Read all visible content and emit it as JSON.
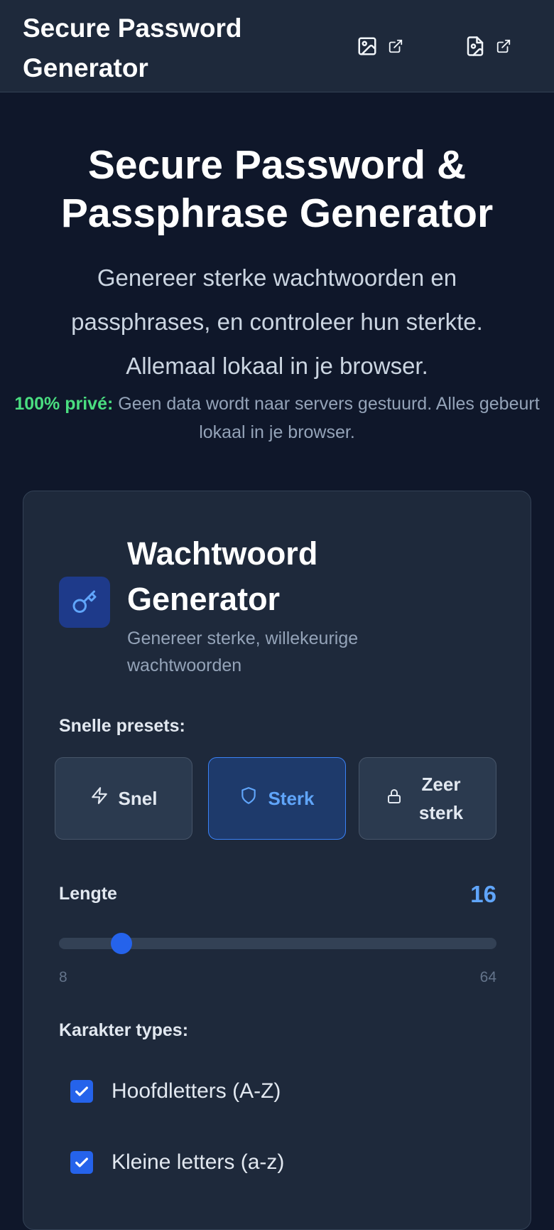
{
  "header": {
    "title": "Secure Password Generator",
    "buttons": [
      {
        "icon": "image-icon",
        "ext_icon": "external-link-icon"
      },
      {
        "icon": "file-image-icon",
        "ext_icon": "external-link-icon"
      }
    ]
  },
  "hero": {
    "title": "Secure Password & Passphrase Generator",
    "subtitle": "Genereer sterke wachtwoorden en passphrases, en controleer hun sterkte. Allemaal lokaal in je browser.",
    "privacy_strong": "100% privé:",
    "privacy_text": "Geen data wordt naar servers gestuurd. Alles gebeurt lokaal in je browser."
  },
  "generator": {
    "icon": "key-icon",
    "title": "Wachtwoord Generator",
    "subtitle": "Genereer sterke, willekeurige wachtwoorden",
    "presets_label": "Snelle presets:",
    "presets": [
      {
        "label": "Snel",
        "icon": "zap-icon",
        "active": false
      },
      {
        "label": "Sterk",
        "icon": "shield-icon",
        "active": true
      },
      {
        "label": "Zeer sterk",
        "icon": "lock-icon",
        "active": false
      }
    ],
    "length_label": "Lengte",
    "length_value": "16",
    "length_min": "8",
    "length_max": "64",
    "char_types_label": "Karakter types:",
    "char_types": [
      {
        "label": "Hoofdletters (A-Z)",
        "checked": true
      },
      {
        "label": "Kleine letters (a-z)",
        "checked": true
      }
    ]
  },
  "colors": {
    "background": "#0f172a",
    "card": "#1e293b",
    "accent": "#3b82f6",
    "privacy_green": "#4ade80"
  }
}
